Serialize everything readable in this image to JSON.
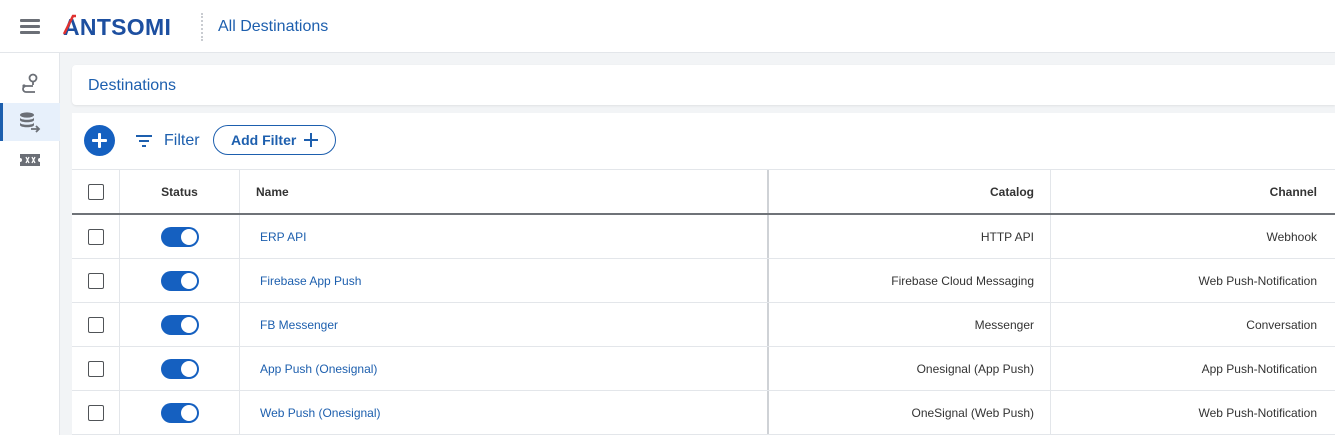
{
  "app": {
    "logo_text": "ANTSOMI",
    "page_title": "All Destinations"
  },
  "rail": {
    "items": [
      {
        "icon": "journey-pin-icon",
        "active": false
      },
      {
        "icon": "database-export-icon",
        "active": true
      },
      {
        "icon": "ticket-icon",
        "active": false
      }
    ]
  },
  "section": {
    "title": "Destinations"
  },
  "toolbar": {
    "filter_label": "Filter",
    "add_filter_label": "Add Filter"
  },
  "table": {
    "columns": {
      "status": "Status",
      "name": "Name",
      "catalog": "Catalog",
      "channel": "Channel"
    },
    "rows": [
      {
        "status": "on",
        "name": "ERP API",
        "catalog": "HTTP API",
        "channel": "Webhook"
      },
      {
        "status": "on",
        "name": "Firebase App Push",
        "catalog": "Firebase Cloud Messaging",
        "channel": "Web Push-Notification"
      },
      {
        "status": "on",
        "name": "FB Messenger",
        "catalog": "Messenger",
        "channel": "Conversation"
      },
      {
        "status": "on",
        "name": "App Push (Onesignal)",
        "catalog": "Onesignal (App Push)",
        "channel": "App Push-Notification"
      },
      {
        "status": "on",
        "name": "Web Push (Onesignal)",
        "catalog": "OneSignal (Web Push)",
        "channel": "Web Push-Notification"
      }
    ]
  },
  "colors": {
    "primary": "#1560c0",
    "link": "#1d5fae"
  }
}
